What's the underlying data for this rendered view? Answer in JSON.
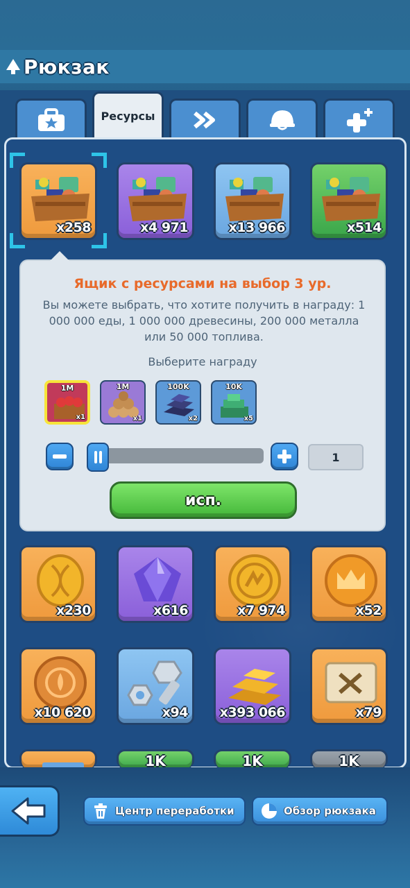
{
  "header": {
    "title": "Рюкзак"
  },
  "tabs": [
    {
      "icon": "briefcase-star-icon",
      "label": ""
    },
    {
      "icon": "",
      "label": "Ресурсы"
    },
    {
      "icon": "double-chevron-right-icon",
      "label": ""
    },
    {
      "icon": "helmet-icon",
      "label": ""
    },
    {
      "icon": "plus-sparkle-icon",
      "label": ""
    }
  ],
  "grid_row1": [
    {
      "icon": "resource-crate-icon",
      "rarity": "orange",
      "count": "x258",
      "selected": true
    },
    {
      "icon": "resource-crate-icon",
      "rarity": "purple",
      "count": "x4 971"
    },
    {
      "icon": "resource-crate-icon",
      "rarity": "blue",
      "count": "x13 966"
    },
    {
      "icon": "resource-crate-icon",
      "rarity": "green",
      "count": "x514"
    }
  ],
  "tooltip": {
    "title": "Ящик с ресурсами на выбор 3 ур.",
    "description": "Вы можете выбрать, что хотите получить в награду: 1 000 000 еды, 1 000 000 древесины, 200 000 металла или 50 000 топлива.",
    "choose_label": "Выберите награду",
    "rewards": [
      {
        "icon": "food-crate-icon",
        "amount": "1M",
        "mult": "x1",
        "selected": true
      },
      {
        "icon": "wood-logs-icon",
        "amount": "1M",
        "mult": "x1"
      },
      {
        "icon": "metal-ingots-icon",
        "amount": "100K",
        "mult": "x2"
      },
      {
        "icon": "fuel-stack-icon",
        "amount": "10K",
        "mult": "x5"
      }
    ],
    "slider": {
      "value": 0.06
    },
    "quantity": "1",
    "use_label": "исп."
  },
  "grid_row2": [
    {
      "icon": "dna-coin-icon",
      "rarity": "orange",
      "count": "x230"
    },
    {
      "icon": "purple-gem-icon",
      "rarity": "purple",
      "count": "x616"
    },
    {
      "icon": "gold-coin-icon",
      "rarity": "orange",
      "count": "x7 974"
    },
    {
      "icon": "crown-coin-icon",
      "rarity": "orange",
      "count": "x52"
    }
  ],
  "grid_row3": [
    {
      "icon": "bronze-coin-icon",
      "rarity": "orange",
      "count": "x10 620"
    },
    {
      "icon": "bolt-nut-icon",
      "rarity": "blue",
      "count": "x94"
    },
    {
      "icon": "gold-bars-icon",
      "rarity": "purple",
      "count": "x393 066"
    },
    {
      "icon": "blueprint-scroll-icon",
      "rarity": "orange",
      "count": "x79"
    }
  ],
  "grid_row4": [
    {
      "rarity": "orange",
      "label": ""
    },
    {
      "rarity": "green",
      "label": "1K"
    },
    {
      "rarity": "green",
      "label": "1K"
    },
    {
      "rarity": "gray",
      "label": "1K"
    }
  ],
  "footer": {
    "back_icon": "back-arrow-icon",
    "recycle_label": "Центр переработки",
    "recycle_icon": "trash-icon",
    "overview_label": "Обзор рюкзака",
    "overview_icon": "pie-chart-icon"
  }
}
